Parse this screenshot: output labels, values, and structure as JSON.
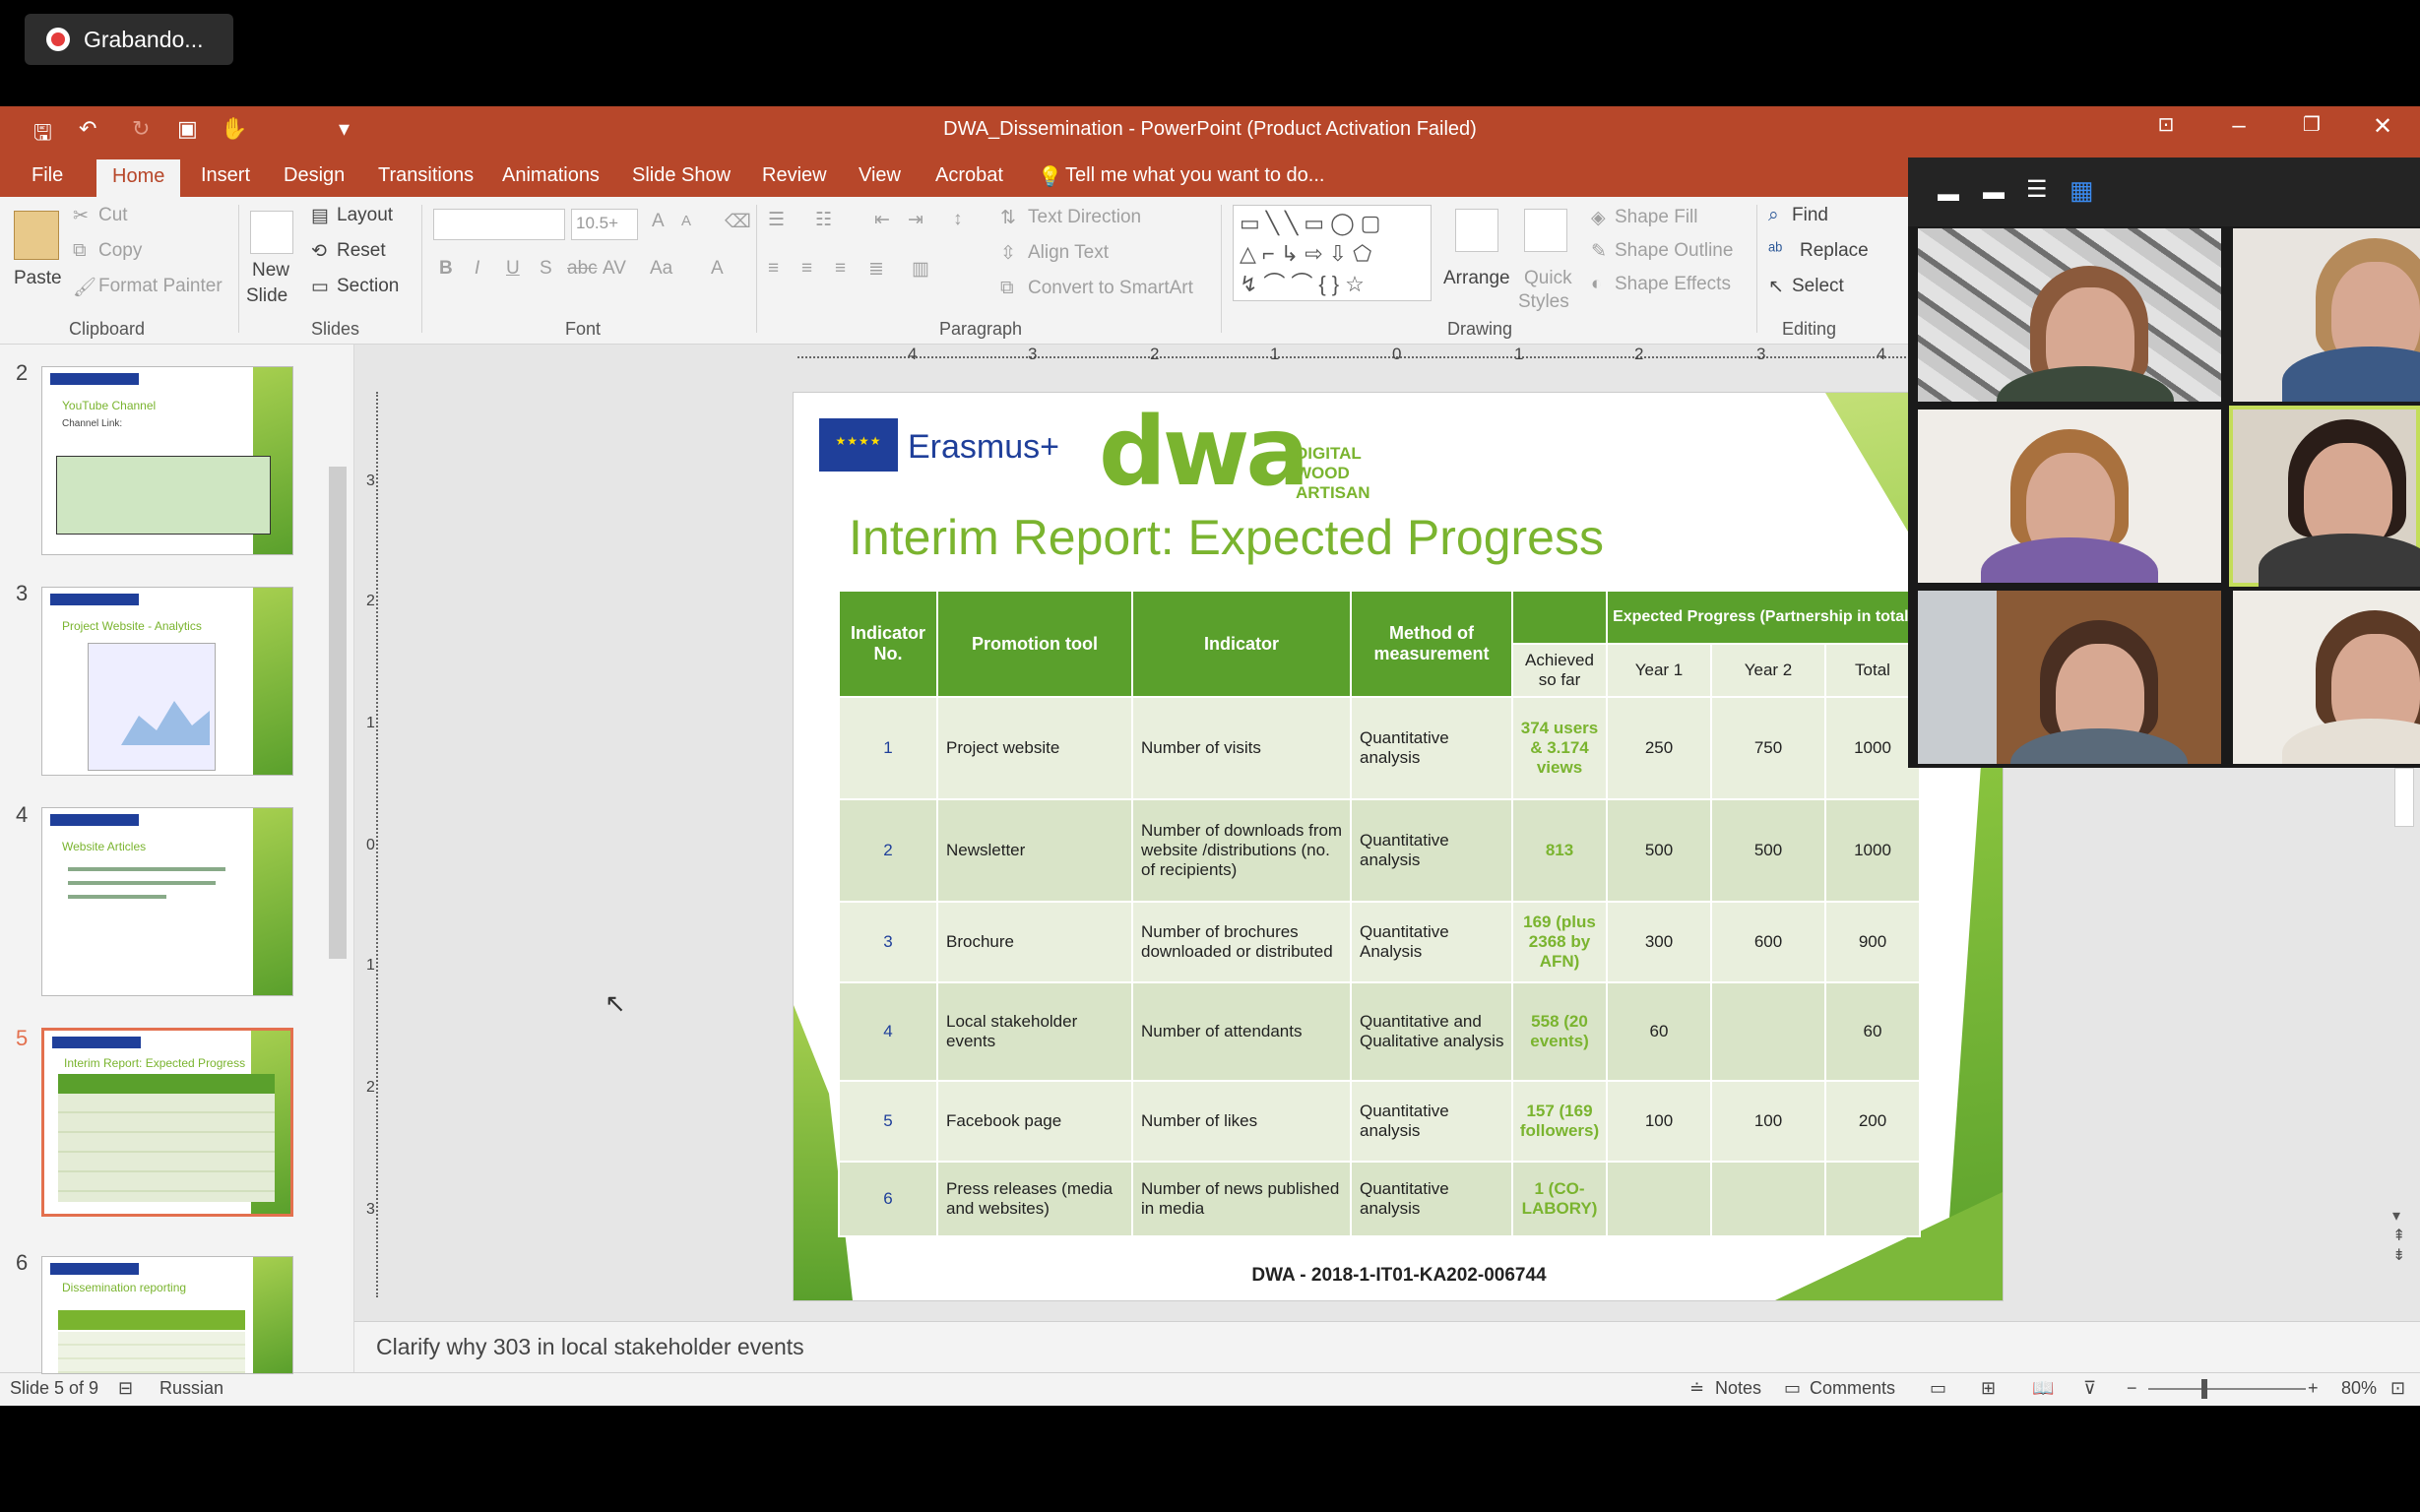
{
  "recording": {
    "label": "Grabando..."
  },
  "window": {
    "title": "DWA_Dissemination - PowerPoint (Product Activation Failed)",
    "tabs": [
      "File",
      "Home",
      "Insert",
      "Design",
      "Transitions",
      "Animations",
      "Slide Show",
      "Review",
      "View",
      "Acrobat"
    ],
    "active_tab": "Home",
    "tell_me": "Tell me what you want to do..."
  },
  "ribbon": {
    "clipboard": {
      "paste": "Paste",
      "cut": "Cut",
      "copy": "Copy",
      "format_painter": "Format Painter",
      "group": "Clipboard"
    },
    "slides": {
      "new_slide_1": "New",
      "new_slide_2": "Slide",
      "layout": "Layout",
      "reset": "Reset",
      "section": "Section",
      "group": "Slides"
    },
    "font": {
      "size": "10.5+",
      "group": "Font",
      "b": "B",
      "i": "I",
      "u": "U",
      "s": "S",
      "abc": "abc",
      "av": "AV",
      "aa": "Aa",
      "grow": "A",
      "shrink": "A",
      "color": "A"
    },
    "paragraph": {
      "text_direction": "Text Direction",
      "align_text": "Align Text",
      "convert": "Convert to SmartArt",
      "group": "Paragraph"
    },
    "drawing": {
      "arrange": "Arrange",
      "quick_styles_1": "Quick",
      "quick_styles_2": "Styles",
      "shape_fill": "Shape Fill",
      "shape_outline": "Shape Outline",
      "shape_effects": "Shape Effects",
      "group": "Drawing"
    },
    "editing": {
      "find": "Find",
      "replace": "Replace",
      "select": "Select",
      "group": "Editing"
    }
  },
  "thumbnails": [
    {
      "num": "2",
      "title": "YouTube Channel",
      "subtitle": "Channel Link:"
    },
    {
      "num": "3",
      "title": "Project Website - Analytics",
      "subtitle": ""
    },
    {
      "num": "4",
      "title": "Website Articles",
      "subtitle": ""
    },
    {
      "num": "5",
      "title": "Interim Report: Expected Progress",
      "subtitle": ""
    },
    {
      "num": "6",
      "title": "Dissemination reporting",
      "subtitle": ""
    }
  ],
  "ruler": {
    "h": [
      "4",
      "3",
      "2",
      "1",
      "0",
      "1",
      "2",
      "3",
      "4"
    ],
    "v": [
      "3",
      "2",
      "1",
      "0",
      "1",
      "2",
      "3"
    ]
  },
  "slide": {
    "eu_stars": "★★★★",
    "erasmus": "Erasmus+",
    "dwa_logo": "dwa",
    "dwa_sub_1": "DIGITAL",
    "dwa_sub_2": "WOOD",
    "dwa_sub_3": "ARTISAN",
    "title": "Interim Report: Expected Progress",
    "table": {
      "headers": [
        "Indicator No.",
        "Promotion tool",
        "Indicator",
        "Method of measurement"
      ],
      "expected_header": "Expected Progress (Partnership in total)",
      "sub_headers": [
        "Achieved so far",
        "Year 1",
        "Year 2",
        "Total"
      ],
      "rows": [
        [
          "1",
          "Project website",
          "Number of visits",
          "Quantitative analysis",
          "374 users & 3.174 views",
          "250",
          "750",
          "1000"
        ],
        [
          "2",
          "Newsletter",
          "Number of downloads from website /distributions (no. of recipients)",
          "Quantitative analysis",
          "813",
          "500",
          "500",
          "1000"
        ],
        [
          "3",
          " Brochure",
          " Number of  brochures downloaded or distributed",
          "Quantitative Analysis",
          "169 (plus 2368 by AFN)",
          "300",
          "600",
          "900"
        ],
        [
          "4",
          " Local stakeholder events",
          "Number of attendants",
          "Quantitative and Qualitative analysis",
          "558 (20 events)",
          "60",
          "",
          "60"
        ],
        [
          "5",
          "Facebook page",
          "Number of likes",
          "Quantitative analysis",
          "157 (169 followers)",
          "100",
          "100",
          "200"
        ],
        [
          "6",
          "Press releases (media and websites)",
          "Number of news published in media",
          "Quantitative analysis",
          "1 (CO-LABORY)",
          "",
          "",
          ""
        ]
      ]
    },
    "footer": "DWA - 2018-1-IT01-KA202-006744"
  },
  "notes": "Clarify why 303 in local stakeholder events",
  "status": {
    "slide_of": "Slide 5 of 9",
    "language": "Russian",
    "notes": "Notes",
    "comments": "Comments",
    "zoom_pct": "80%"
  },
  "video_tiles": 6
}
